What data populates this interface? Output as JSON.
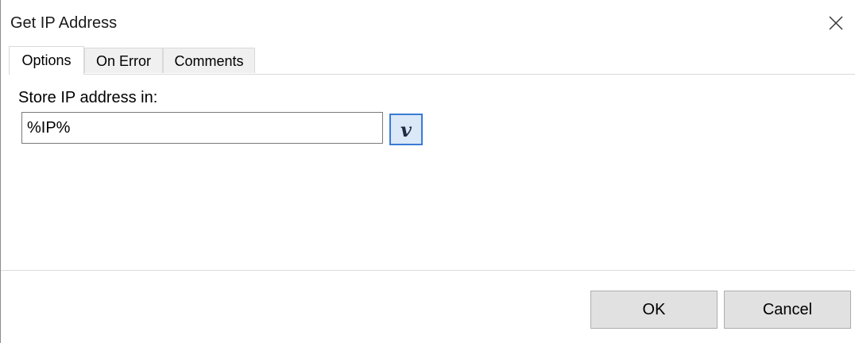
{
  "window": {
    "title": "Get IP Address"
  },
  "tabs": [
    {
      "label": "Options",
      "active": true
    },
    {
      "label": "On Error",
      "active": false
    },
    {
      "label": "Comments",
      "active": false
    }
  ],
  "options": {
    "store_label": "Store IP address in:",
    "store_value": "%IP%",
    "variable_button_label": "v"
  },
  "buttons": {
    "ok": "OK",
    "cancel": "Cancel"
  },
  "icons": {
    "close": "close-icon"
  },
  "colors": {
    "accent_border": "#3a7bd5",
    "accent_fill": "#dbe8f7"
  }
}
